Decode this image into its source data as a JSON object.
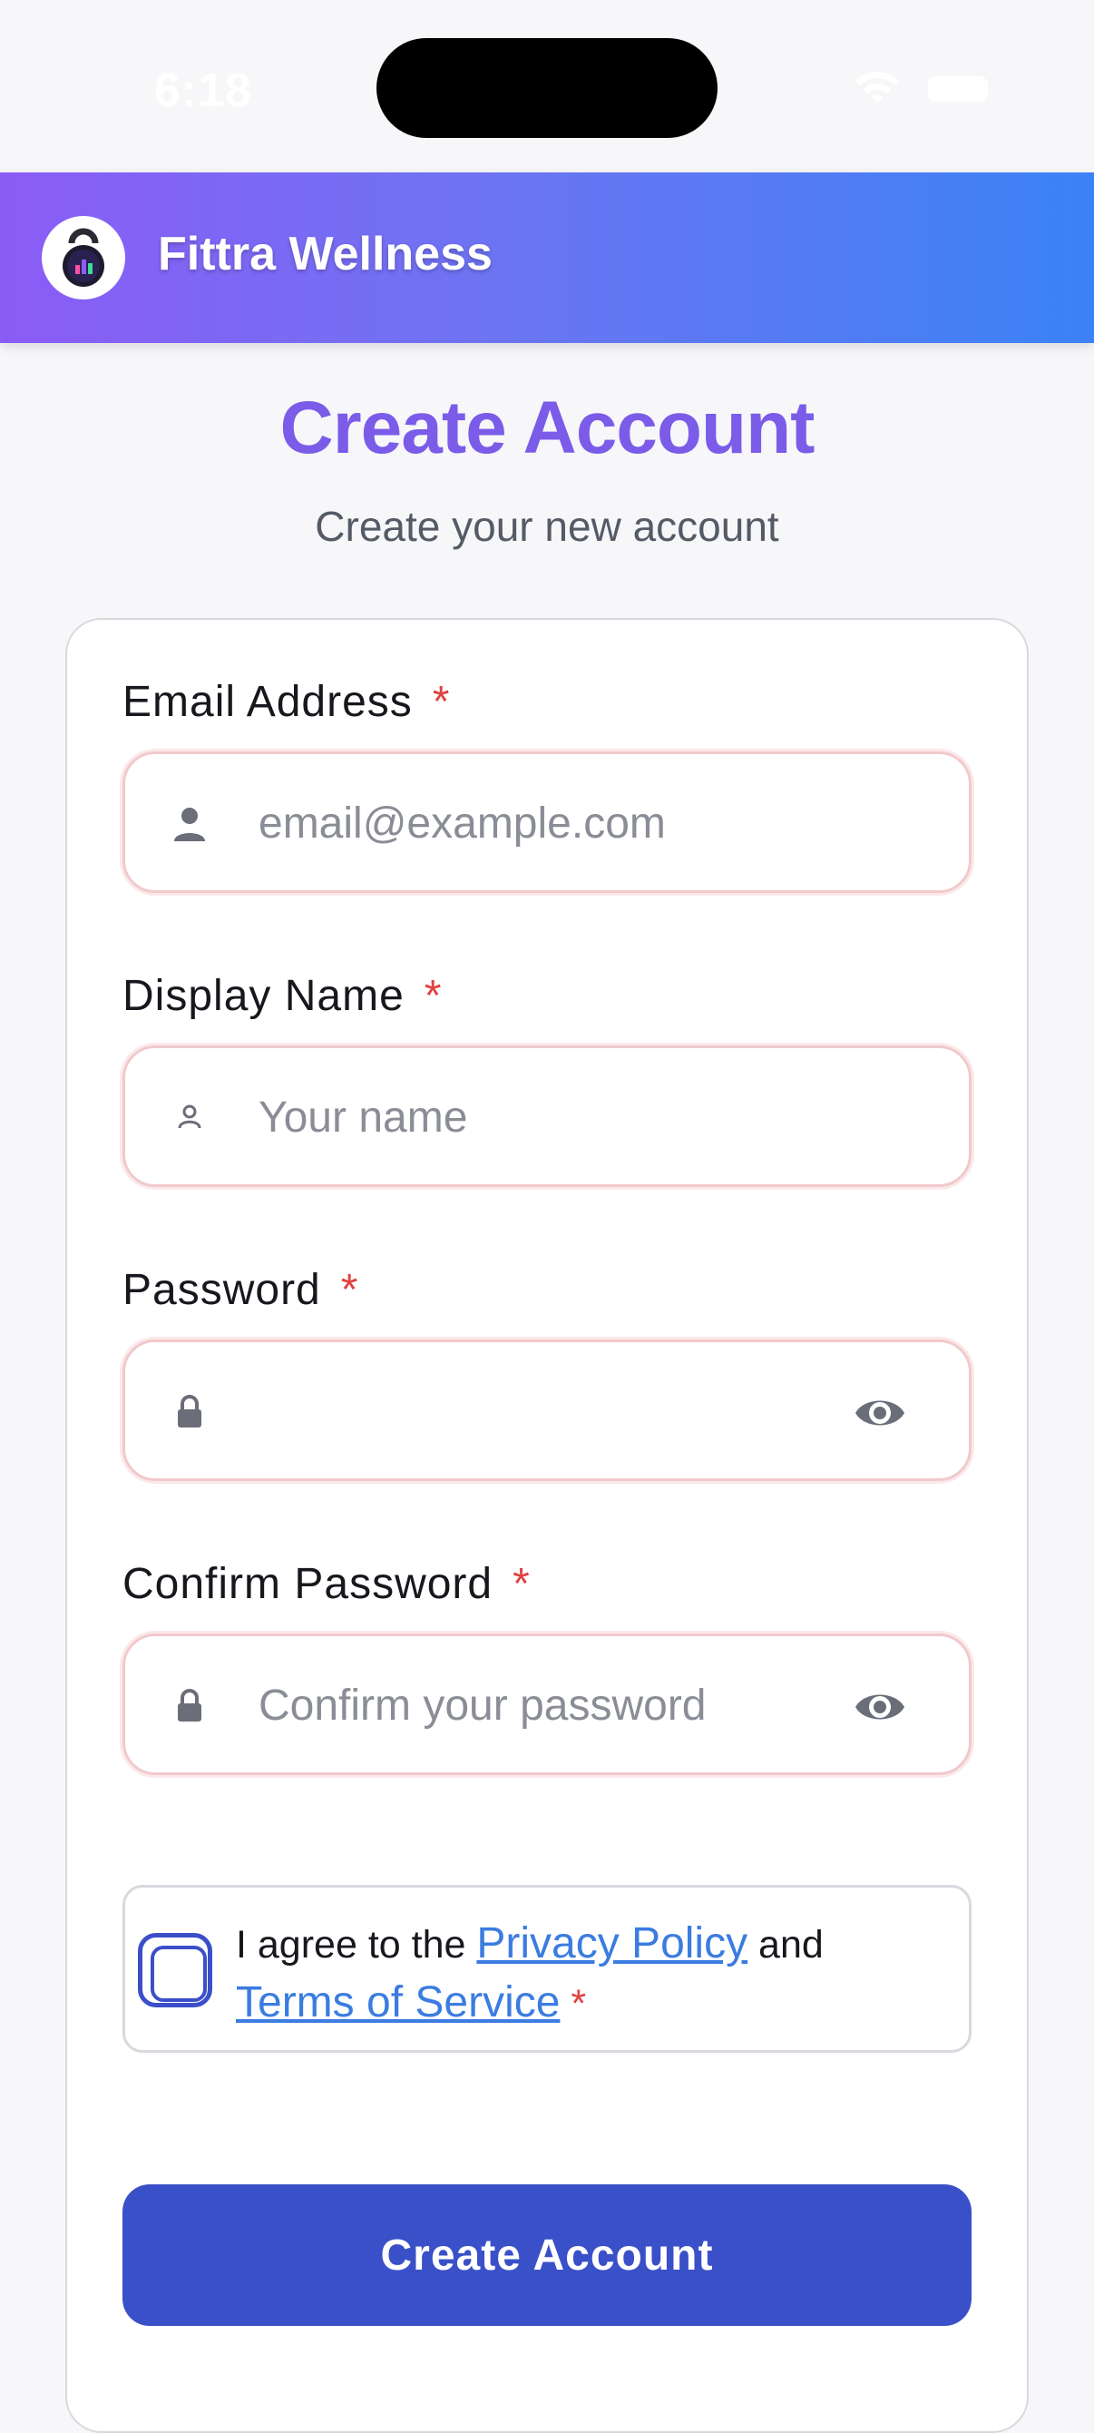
{
  "status_bar": {
    "time": "6:18"
  },
  "header": {
    "app_name": "Fittra Wellness"
  },
  "page": {
    "title": "Create Account",
    "subtitle": "Create your new account"
  },
  "form": {
    "email": {
      "label": "Email Address",
      "required": "*",
      "placeholder": "email@example.com",
      "value": ""
    },
    "display_name": {
      "label": "Display Name",
      "required": "*",
      "placeholder": "Your name",
      "value": ""
    },
    "password": {
      "label": "Password",
      "required": "*",
      "placeholder": "",
      "value": ""
    },
    "confirm_password": {
      "label": "Confirm Password",
      "required": "*",
      "placeholder": "Confirm your password",
      "value": ""
    },
    "agreement": {
      "prefix": "I agree to the ",
      "privacy_link": "Privacy Policy",
      "middle": " and",
      "terms_link": "Terms of Service",
      "required": "*"
    },
    "submit_label": "Create Account"
  },
  "colors": {
    "header_gradient_start": "#8b5cf6",
    "header_gradient_end": "#3b82f6",
    "title": "#7b5ce9",
    "required": "#e0413f",
    "primary_button": "#3a50c8",
    "link": "#3b7ce0"
  },
  "icons": [
    "wifi-icon",
    "battery-icon",
    "kettlebell-logo-icon",
    "user-icon",
    "user-outline-icon",
    "lock-icon",
    "eye-icon"
  ]
}
